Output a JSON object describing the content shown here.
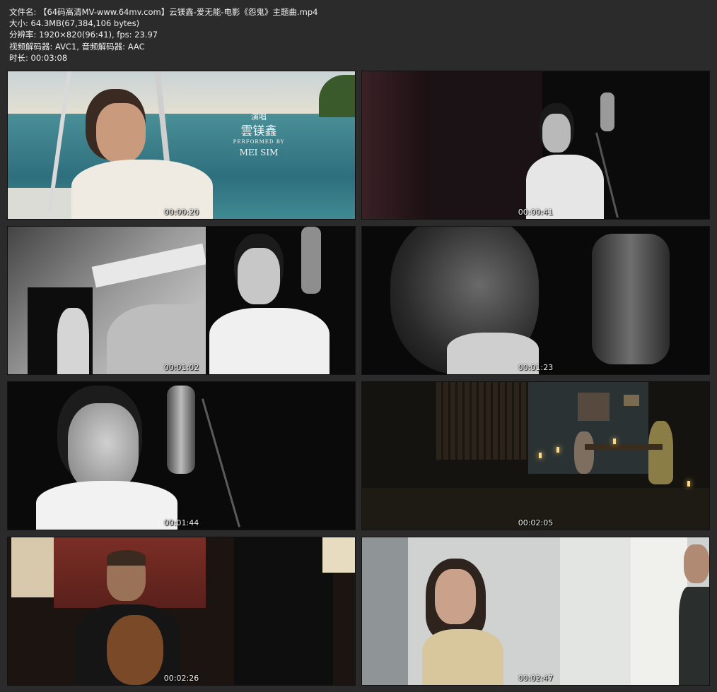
{
  "info": {
    "filename": "文件名: 【64码高清MV-www.64mv.com】云镁鑫-爱无能-电影《怨鬼》主题曲.mp4",
    "size": "大小: 64.3MB(67,384,106 bytes)",
    "resolution": "分辨率: 1920×820(96:41), fps: 23.97",
    "codec": "视频解码器: AVC1, 音频解码器: AAC",
    "duration": "时长: 00:03:08"
  },
  "overlay": {
    "line1": "演唱",
    "line2": "雲镁鑫",
    "line3": "PERFORMED BY",
    "line4": "MEI SIM"
  },
  "thumbnails": [
    {
      "timestamp": "00:00:20"
    },
    {
      "timestamp": "00:00:41"
    },
    {
      "timestamp": "00:01:02"
    },
    {
      "timestamp": "00:01:23"
    },
    {
      "timestamp": "00:01:44"
    },
    {
      "timestamp": "00:02:05"
    },
    {
      "timestamp": "00:02:26"
    },
    {
      "timestamp": "00:02:47"
    }
  ]
}
